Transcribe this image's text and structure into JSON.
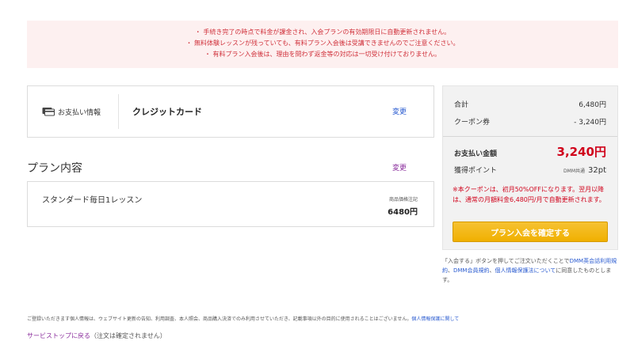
{
  "notice": {
    "lines": [
      "・ 手続き完了の時点で料金が課金され、入会プランの有効期限日に自動更新されません。",
      "・ 無料体験レッスンが残っていても、有料プラン入会後は受講できませんのでご注意ください。",
      "・ 有料プラン入会後は、理由を問わず返金等の対応は一切受け付けておりません。"
    ]
  },
  "payment": {
    "label": "お支払い情報",
    "method": "クレジットカード",
    "change_label": "変更"
  },
  "plan": {
    "title": "プラン内容",
    "change_label": "変更",
    "name": "スタンダード毎日1レッスン",
    "price_note": "商品価格注記",
    "price": "6480円"
  },
  "summary": {
    "subtotal_label": "合計",
    "subtotal_value": "6,480円",
    "coupon_label": "クーポン券",
    "coupon_value": "- 3,240円",
    "total_label": "お支払い金額",
    "total_value": "3,240円",
    "points_label": "獲得ポイント",
    "points_prefix": "DMM共通",
    "points_value": "32pt",
    "coupon_note": "※本クーポンは、初月50%OFFになります。翌月以降は、通常の月額料金6,480円/月で自動更新されます。",
    "confirm_label": "プラン入会を確定する"
  },
  "agreement": {
    "text_before": "「入会する」ボタンを押してご注文いただくことで",
    "link1": "DMM英会話利用規約",
    "sep": "、",
    "link2": "DMM会員規約",
    "sep2": "、",
    "link3": "個人情報保護法について",
    "text_after": "に同意したものとします。"
  },
  "footer": {
    "privacy_text": "ご登録いただきます個人情報は、ウェブサイト更新の告知、利用調査、本人照会、商品購入決済でのみ利用させていただき、記載事項以外の目的に使用されることはございません。",
    "privacy_link": "個人情報保護に関して",
    "back_link": "サービストップに戻る",
    "back_note": "（注文は確定されません）"
  },
  "colors": {
    "accent_red": "#d0021b",
    "link_blue": "#2a5bd0",
    "link_purple": "#8a2d9c",
    "button_yellow": "#f0b000"
  }
}
